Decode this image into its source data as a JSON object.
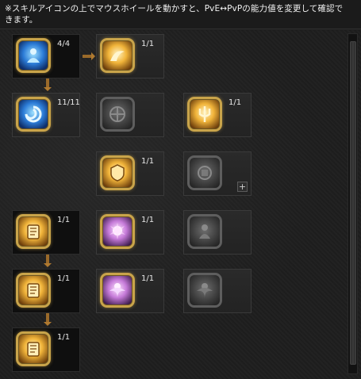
{
  "notice": "※スキルアイコンの上でマウスホイールを動かすと、PvE↔PvPの能力値を変更して確認できます。",
  "skills": [
    {
      "id": "r1c1",
      "count": "4/4",
      "icon": "blue-spirit-icon",
      "state": "learned"
    },
    {
      "id": "r1c2",
      "count": "1/1",
      "icon": "golden-leap-icon",
      "state": "learned"
    },
    {
      "id": "r2c1",
      "count": "11/11",
      "icon": "blue-vortex-icon",
      "state": "learned"
    },
    {
      "id": "r2c2",
      "count": "",
      "icon": "locked-cross-icon",
      "state": "locked"
    },
    {
      "id": "r2c3",
      "count": "1/1",
      "icon": "golden-trident-icon",
      "state": "learned"
    },
    {
      "id": "r3c2",
      "count": "1/1",
      "icon": "golden-shield-icon",
      "state": "learned"
    },
    {
      "id": "r3c3",
      "count": "",
      "icon": "locked-emblem-icon",
      "state": "locked",
      "plus": "+"
    },
    {
      "id": "r4c1",
      "count": "1/1",
      "icon": "golden-scroll-icon",
      "state": "learned"
    },
    {
      "id": "r4c2",
      "count": "1/1",
      "icon": "violet-burst-icon",
      "state": "learned"
    },
    {
      "id": "r4c3",
      "count": "",
      "icon": "locked-figure-icon",
      "state": "locked"
    },
    {
      "id": "r5c1",
      "count": "1/1",
      "icon": "golden-scroll-icon",
      "state": "learned"
    },
    {
      "id": "r5c2",
      "count": "1/1",
      "icon": "violet-angel-icon",
      "state": "learned"
    },
    {
      "id": "r5c3",
      "count": "",
      "icon": "locked-angel-icon",
      "state": "locked"
    },
    {
      "id": "r6c1",
      "count": "1/1",
      "icon": "golden-scroll-icon",
      "state": "learned"
    }
  ],
  "colors": {
    "gold_border": "#c9a44a",
    "arrow": "#9a6a2a",
    "locked_border": "#5e5e5e"
  }
}
